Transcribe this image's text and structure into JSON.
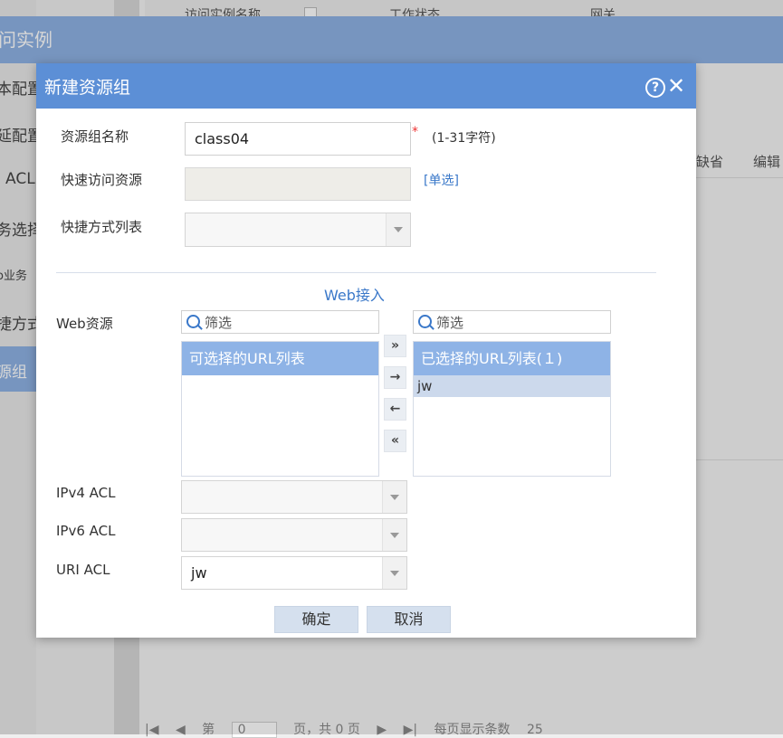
{
  "background": {
    "banner_title": "问实例",
    "table_headers": [
      "访问实例名称",
      "工作状态",
      "网关"
    ],
    "nav_items": [
      "本配置",
      "延配置",
      "ACL",
      "务选择",
      "o业务",
      "捷方式",
      "源组"
    ],
    "right_buttons": [
      "缺省",
      "编辑"
    ],
    "pager": {
      "page_label": "第",
      "page_value": "0",
      "total_label": "页，共 0 页",
      "per_page_label": "每页显示条数",
      "per_page_value": "25"
    }
  },
  "dialog": {
    "title": "新建资源组",
    "name_label": "资源组名称",
    "name_value": "class04",
    "required_mark": "*",
    "name_hint": "(1-31字符)",
    "quick_access_label": "快速访问资源",
    "quick_access_value": "",
    "single_select_link": "[单选]",
    "shortcut_label": "快捷方式列表",
    "shortcut_value": "",
    "section_title": "Web接入",
    "web_resource_label": "Web资源",
    "filter_placeholder": "筛选",
    "available_list_title": "可选择的URL列表",
    "selected_list_title": "已选择的URL列表(１)",
    "selected_items": [
      "jw"
    ],
    "ipv4_acl_label": "IPv4 ACL",
    "ipv4_acl_value": "",
    "ipv6_acl_label": "IPv6 ACL",
    "ipv6_acl_value": "",
    "uri_acl_label": "URI ACL",
    "uri_acl_value": "jw",
    "confirm_button": "确定",
    "cancel_button": "取消"
  },
  "icons": [
    "help-icon",
    "close-icon",
    "search-icon",
    "move-all-right-icon",
    "move-right-icon",
    "move-left-icon",
    "move-all-left-icon",
    "dropdown-arrow-icon"
  ],
  "colors": {
    "header": "#5c8fd6",
    "list_header": "#8eb3e6",
    "link": "#3a78c9",
    "selected_row": "#ccd9ec"
  }
}
